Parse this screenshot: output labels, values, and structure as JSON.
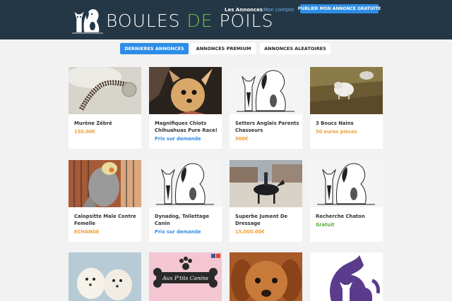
{
  "brand": {
    "name_part1": "BOULES",
    "name_part2": "DE",
    "name_part3": "POILS"
  },
  "nav": {
    "annonces": "Les Annonces",
    "compte": "Mon compte",
    "publish": "PUBLIER MON ANNONCE GRATUITE"
  },
  "tabs": [
    {
      "label": "DERNIERES ANNONCES",
      "active": true
    },
    {
      "label": "ANNONCES PREMIUM",
      "active": false
    },
    {
      "label": "ANNONCES ALEATOIRES",
      "active": false
    }
  ],
  "listings": [
    {
      "title": "Murène Zébré",
      "price": "150.00€",
      "price_color": "#f0a030",
      "image": "eel-photo"
    },
    {
      "title": "Magnifiques Chiots Chihuahuas Pure Race!",
      "price": "Prix sur demande",
      "price_color": "#2d8de6",
      "image": "chihuahua-photo"
    },
    {
      "title": "Setters Anglais Parents Chasseurs",
      "price": "900€",
      "price_color": "#f0a030",
      "image": "placeholder-logo"
    },
    {
      "title": "3 Boucs Nains",
      "price": "50 euros pieces",
      "price_color": "#f0a030",
      "image": "goats-photo"
    },
    {
      "title": "Calopsitte Male Contre Femelle",
      "price": "ECHANGE",
      "price_color": "#f0a030",
      "image": "cockatiel-photo"
    },
    {
      "title": "Dynadog, Toilettage Canin",
      "price": "Prix sur demande",
      "price_color": "#2d8de6",
      "image": "placeholder-logo"
    },
    {
      "title": "Superbe Jument De Dressage",
      "price": "15,000.00€",
      "price_color": "#f0a030",
      "image": "horse-photo"
    },
    {
      "title": "Recherche Chaton",
      "price": "Gratuit",
      "price_color": "#5aad3a",
      "image": "placeholder-logo"
    },
    {
      "title": "",
      "price": "",
      "image": "puppies-photo"
    },
    {
      "title": "",
      "price": "",
      "image": "banner-image",
      "banner_text": "Aux P'tits Canins"
    },
    {
      "title": "",
      "price": "",
      "image": "spaniel-photo"
    },
    {
      "title": "",
      "price": "",
      "image": "purple-logo"
    }
  ]
}
